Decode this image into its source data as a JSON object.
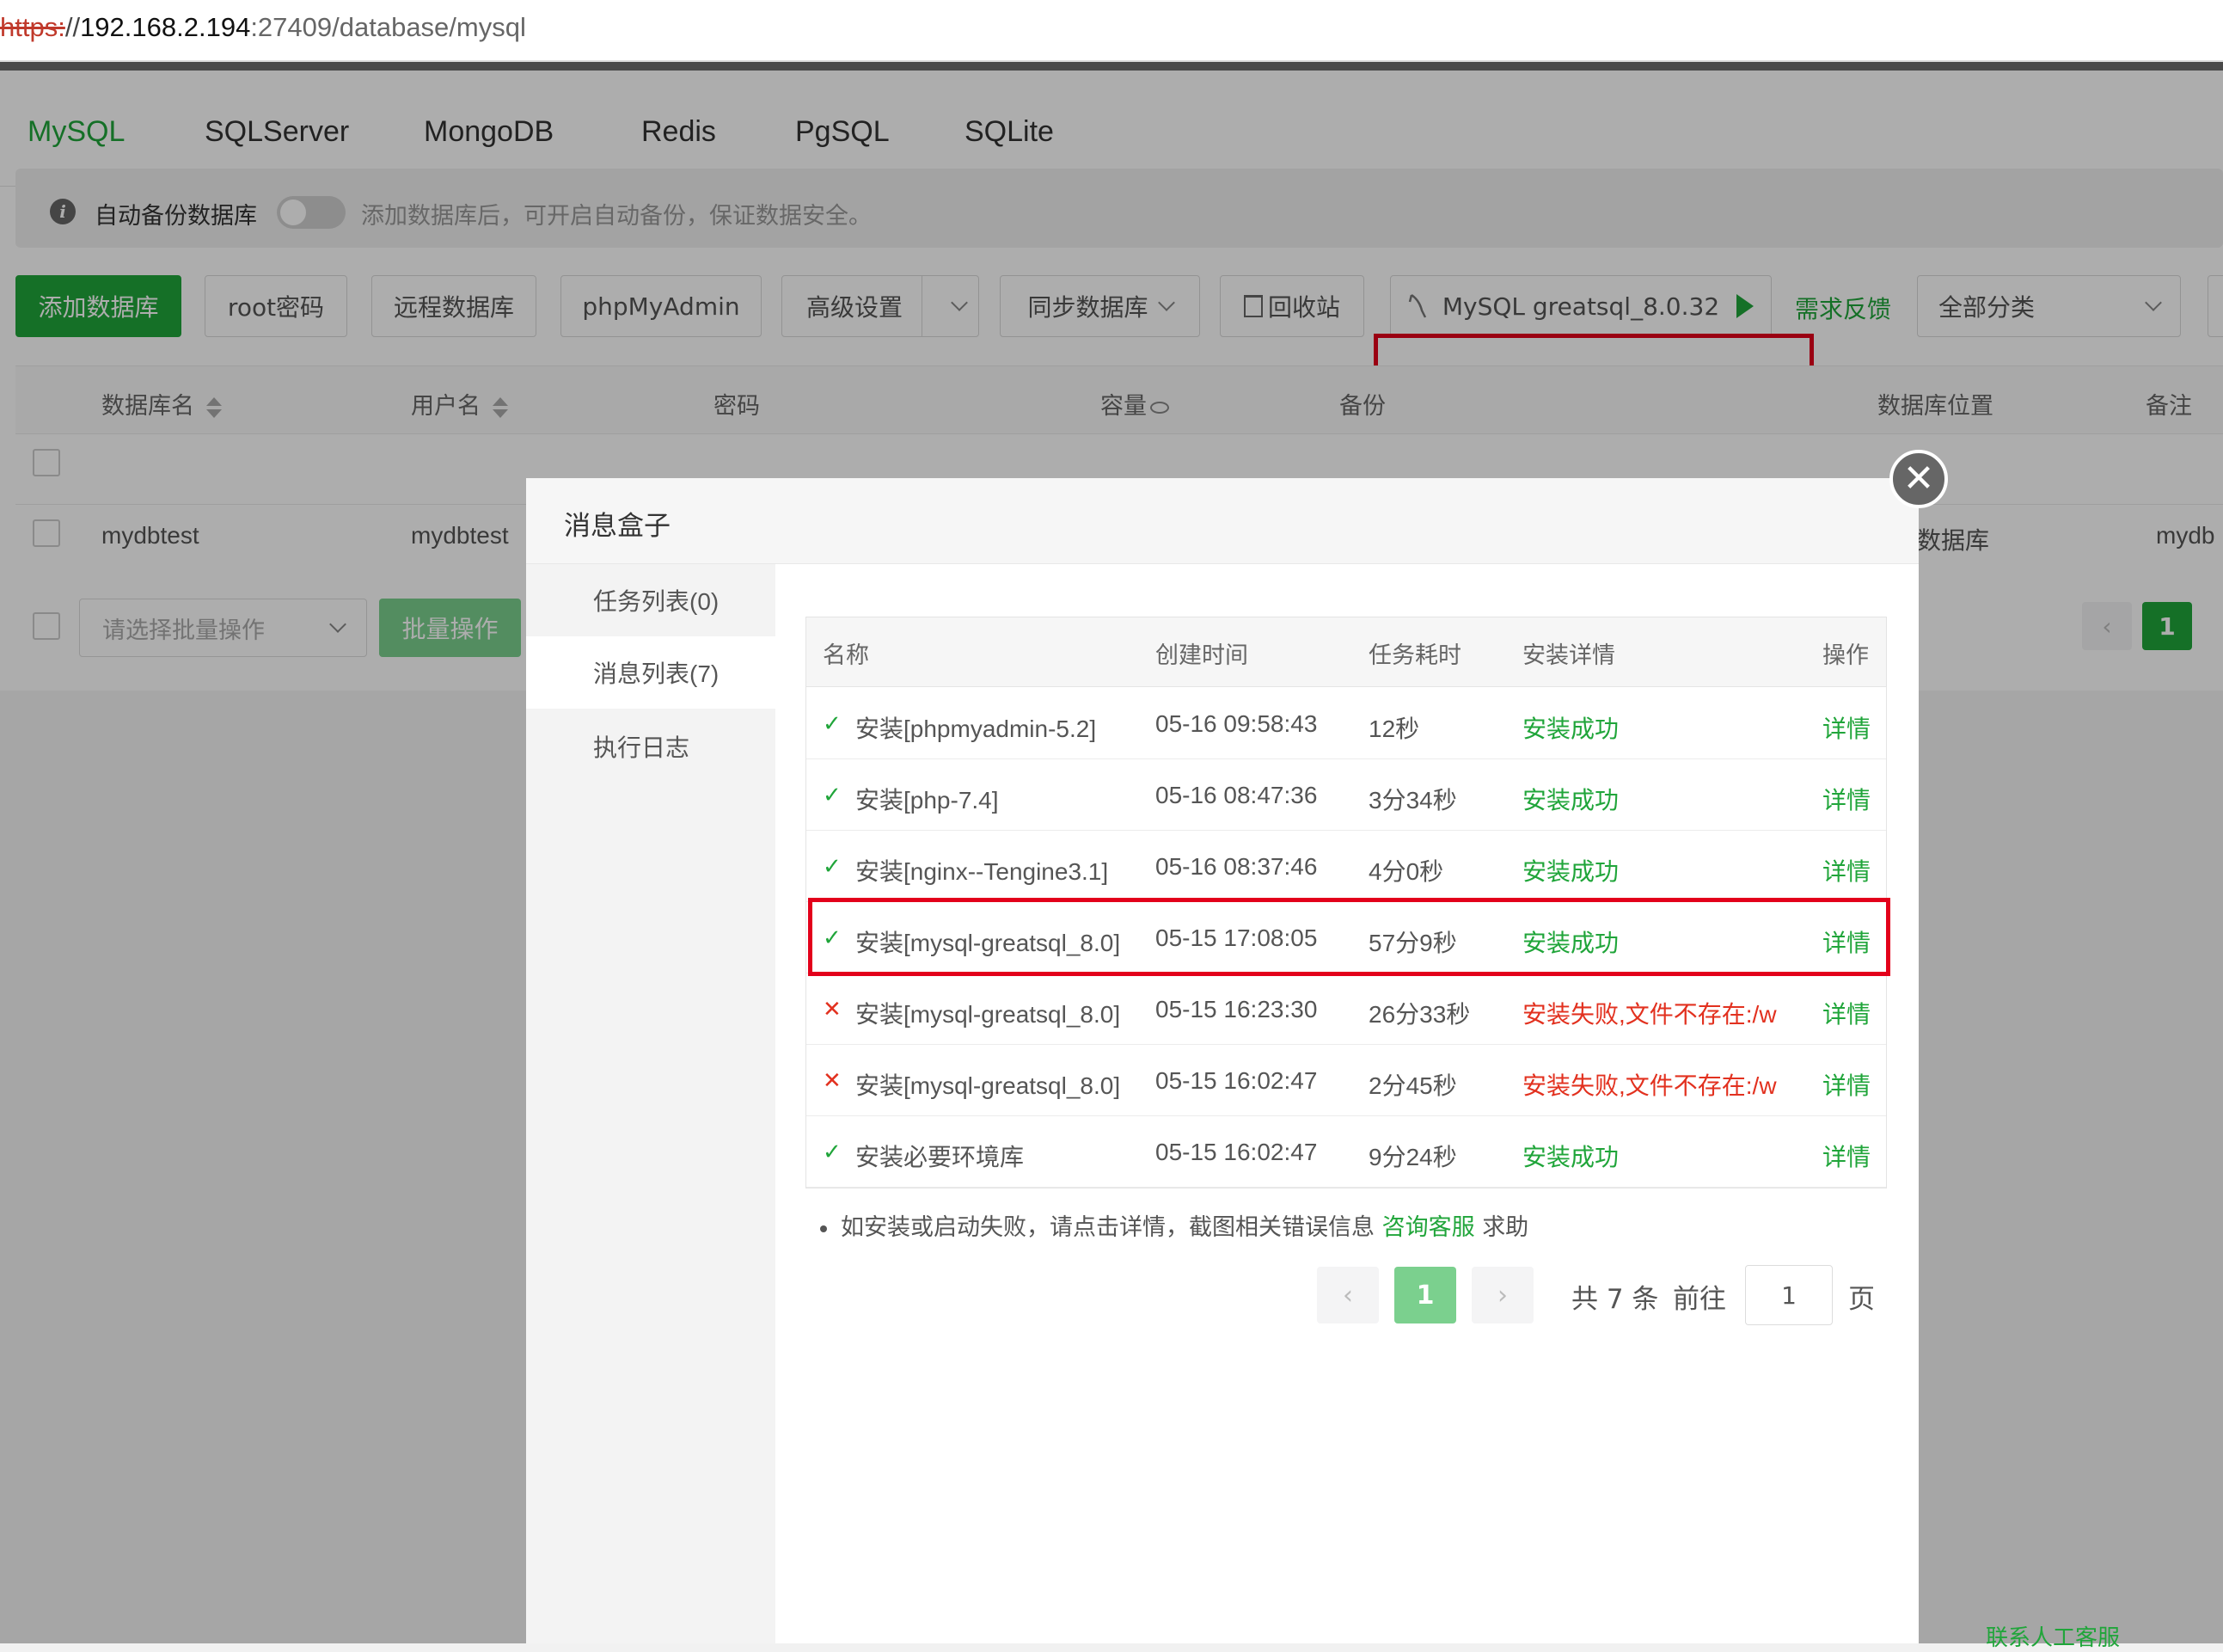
{
  "browser": {
    "url_proto": "https:",
    "url_sep": "//",
    "url_host": "192.168.2.194",
    "url_path": ":27409/database/mysql"
  },
  "tabs": [
    "MySQL",
    "SQLServer",
    "MongoDB",
    "Redis",
    "PgSQL",
    "SQLite"
  ],
  "alert": {
    "title": "自动备份数据库",
    "desc": "添加数据库后，可开启自动备份，保证数据安全。"
  },
  "toolbar": {
    "add_db": "添加数据库",
    "root_pwd": "root密码",
    "remote_db": "远程数据库",
    "phpmyadmin": "phpMyAdmin",
    "advanced": "高级设置",
    "sync_db": "同步数据库",
    "recycle": "回收站",
    "mysql_version": "MySQL greatsql_8.0.32",
    "feedback": "需求反馈",
    "category": "全部分类"
  },
  "db_table": {
    "headers": {
      "name": "数据库名",
      "user": "用户名",
      "password": "密码",
      "capacity": "容量",
      "backup": "备份",
      "location": "数据库位置",
      "remark": "备注"
    },
    "row": {
      "name": "mydbtest",
      "user": "mydbtest",
      "location": "数据库",
      "remark": "mydb"
    }
  },
  "batch": {
    "placeholder": "请选择批量操作",
    "button": "批量操作"
  },
  "db_pager": {
    "current": "1",
    "prev": "‹"
  },
  "modal": {
    "title": "消息盒子",
    "side": [
      "任务列表(0)",
      "消息列表(7)",
      "执行日志"
    ],
    "headers": {
      "name": "名称",
      "created": "创建时间",
      "duration": "任务耗时",
      "detail": "安装详情",
      "action": "操作"
    },
    "rows": [
      {
        "status": "ok",
        "name": "安装[phpmyadmin-5.2]",
        "created": "05-16 09:58:43",
        "duration": "12秒",
        "detail": "安装成功",
        "action": "详情"
      },
      {
        "status": "ok",
        "name": "安装[php-7.4]",
        "created": "05-16 08:47:36",
        "duration": "3分34秒",
        "detail": "安装成功",
        "action": "详情"
      },
      {
        "status": "ok",
        "name": "安装[nginx--Tengine3.1]",
        "created": "05-16 08:37:46",
        "duration": "4分0秒",
        "detail": "安装成功",
        "action": "详情"
      },
      {
        "status": "ok",
        "name": "安装[mysql-greatsql_8.0]",
        "created": "05-15 17:08:05",
        "duration": "57分9秒",
        "detail": "安装成功",
        "action": "详情"
      },
      {
        "status": "fail",
        "name": "安装[mysql-greatsql_8.0]",
        "created": "05-15 16:23:30",
        "duration": "26分33秒",
        "detail": "安装失败,文件不存在:/w",
        "action": "详情"
      },
      {
        "status": "fail",
        "name": "安装[mysql-greatsql_8.0]",
        "created": "05-15 16:02:47",
        "duration": "2分45秒",
        "detail": "安装失败,文件不存在:/w",
        "action": "详情"
      },
      {
        "status": "ok",
        "name": "安装必要环境库",
        "created": "05-15 16:02:47",
        "duration": "9分24秒",
        "detail": "安装成功",
        "action": "详情"
      }
    ],
    "note_prefix": "如安装或启动失败，请点击详情，截图相关错误信息",
    "note_link": "咨询客服",
    "note_suffix": "求助",
    "pager": {
      "current": "1",
      "total": "共 7 条",
      "goto": "前往",
      "goto_value": "1",
      "page": "页",
      "prev": "‹",
      "next": "›"
    }
  },
  "footer": {
    "link": "联系人工客服"
  },
  "icons": {
    "ok": "✓",
    "fail": "✕",
    "close": "✕",
    "info": "i",
    "trash": "🗑",
    "mysql": "dolphin-icon"
  },
  "colors": {
    "accent": "#20a53a",
    "danger": "#e2311f",
    "highlight": "#e3001b"
  }
}
